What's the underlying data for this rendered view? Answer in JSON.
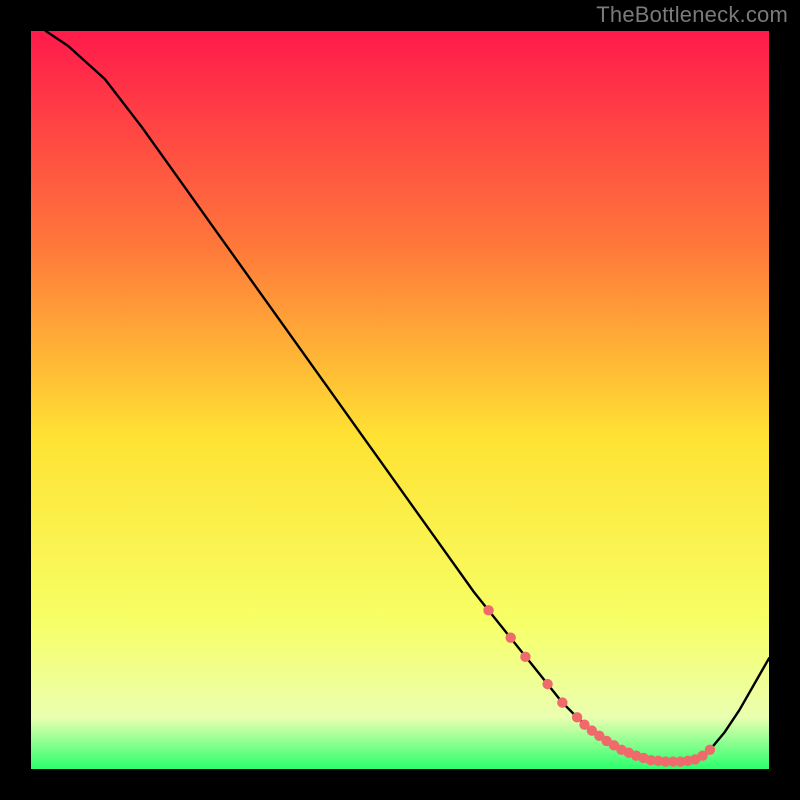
{
  "watermark": "TheBottleneck.com",
  "chart_data": {
    "type": "line",
    "title": "",
    "xlabel": "",
    "ylabel": "",
    "xlim": [
      0,
      100
    ],
    "ylim": [
      0,
      100
    ],
    "grid": false,
    "legend": false,
    "background_gradient": {
      "top": "#ff1a4b",
      "mid_upper": "#ff7b3a",
      "mid": "#ffe233",
      "mid_lower": "#f7ff66",
      "bottom": "#2bff6e"
    },
    "series": [
      {
        "name": "curve",
        "type": "line",
        "color": "#000000",
        "x": [
          2,
          5,
          10,
          15,
          20,
          25,
          30,
          35,
          40,
          45,
          50,
          55,
          60,
          62,
          64,
          66,
          68,
          70,
          72,
          74,
          76,
          78,
          80,
          82,
          84,
          86,
          88,
          90,
          92,
          94,
          96,
          98,
          100
        ],
        "y": [
          100,
          98,
          93.5,
          87,
          80,
          73,
          66,
          59,
          52,
          45,
          38,
          31,
          24,
          21.5,
          19,
          16.5,
          14,
          11.5,
          9,
          7,
          5.2,
          3.8,
          2.6,
          1.8,
          1.2,
          1.0,
          1.0,
          1.3,
          2.6,
          5.0,
          8.0,
          11.5,
          15
        ]
      },
      {
        "name": "marker-dots",
        "type": "scatter",
        "color": "#ef6a6a",
        "x": [
          62,
          65,
          67,
          70,
          72,
          74,
          75,
          76,
          77,
          78,
          79,
          80,
          81,
          82,
          83,
          84,
          85,
          86,
          87,
          88,
          89,
          90,
          91,
          92
        ],
        "y": [
          21.5,
          17.8,
          15.2,
          11.5,
          9.0,
          7.0,
          6.0,
          5.2,
          4.5,
          3.8,
          3.2,
          2.6,
          2.2,
          1.8,
          1.5,
          1.2,
          1.1,
          1.0,
          1.0,
          1.0,
          1.1,
          1.3,
          1.8,
          2.6
        ]
      }
    ]
  }
}
